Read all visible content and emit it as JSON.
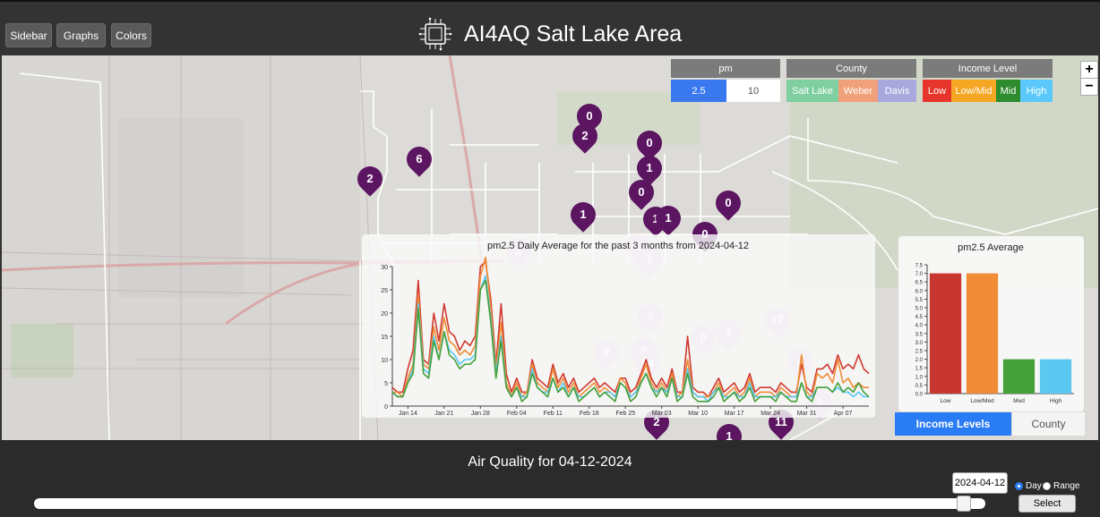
{
  "header": {
    "sidebar_label": "Sidebar",
    "graphs_label": "Graphs",
    "colors_label": "Colors",
    "title": "AI4AQ Salt Lake Area"
  },
  "filters": {
    "pm": {
      "title": "pm",
      "options": [
        "2.5",
        "10"
      ],
      "selected": "2.5"
    },
    "county": {
      "title": "County",
      "options": [
        "Salt Lake",
        "Weber",
        "Davis"
      ]
    },
    "income": {
      "title": "Income Level",
      "options": [
        "Low",
        "Low/Mid",
        "Mid",
        "High"
      ]
    }
  },
  "zoom": {
    "in_label": "+",
    "out_label": "−"
  },
  "markers": [
    "0",
    "2",
    "0",
    "1",
    "6",
    "2",
    "0",
    "0",
    "1",
    "1",
    "1",
    "0",
    "1",
    "2",
    "1",
    "3",
    "1",
    "0",
    "17",
    "0",
    "0",
    "14",
    "0",
    "0",
    "2",
    "11",
    "1"
  ],
  "line_chart": {
    "title": "pm2.5 Daily Average for the past 3 months from 2024-04-12",
    "yticks": [
      "0",
      "5",
      "10",
      "15",
      "20",
      "25",
      "30"
    ],
    "xticks": [
      "Jan 14",
      "Jan 21",
      "Jan 28",
      "Feb 04",
      "Feb 11",
      "Feb 18",
      "Feb 25",
      "Mar 03",
      "Mar 10",
      "Mar 17",
      "Mar 24",
      "Mar 31",
      "Apr 07"
    ]
  },
  "bar_chart": {
    "title": "pm2.5 Average",
    "yticks": [
      "0.0",
      "0.5",
      "1.0",
      "1.5",
      "2.0",
      "2.5",
      "3.0",
      "3.5",
      "4.0",
      "4.5",
      "5.0",
      "5.5",
      "6.0",
      "6.5",
      "7.0",
      "7.5"
    ]
  },
  "chart_data": [
    {
      "type": "line",
      "title": "pm2.5 Daily Average for the past 3 months from 2024-04-12",
      "xlabel": "",
      "ylabel": "",
      "ylim": [
        0,
        30
      ],
      "x": [
        "2024-01-11",
        "2024-01-12",
        "2024-01-13",
        "2024-01-14",
        "2024-01-15",
        "2024-01-16",
        "2024-01-17",
        "2024-01-18",
        "2024-01-19",
        "2024-01-20",
        "2024-01-21",
        "2024-01-22",
        "2024-01-23",
        "2024-01-24",
        "2024-01-25",
        "2024-01-26",
        "2024-01-27",
        "2024-01-28",
        "2024-01-29",
        "2024-01-30",
        "2024-01-31",
        "2024-02-01",
        "2024-02-02",
        "2024-02-03",
        "2024-02-04",
        "2024-02-05",
        "2024-02-06",
        "2024-02-07",
        "2024-02-08",
        "2024-02-09",
        "2024-02-10",
        "2024-02-11",
        "2024-02-12",
        "2024-02-13",
        "2024-02-14",
        "2024-02-15",
        "2024-02-16",
        "2024-02-17",
        "2024-02-18",
        "2024-02-19",
        "2024-02-20",
        "2024-02-21",
        "2024-02-22",
        "2024-02-23",
        "2024-02-24",
        "2024-02-25",
        "2024-02-26",
        "2024-02-27",
        "2024-02-28",
        "2024-02-29",
        "2024-03-01",
        "2024-03-02",
        "2024-03-03",
        "2024-03-04",
        "2024-03-05",
        "2024-03-06",
        "2024-03-07",
        "2024-03-08",
        "2024-03-09",
        "2024-03-10",
        "2024-03-11",
        "2024-03-12",
        "2024-03-13",
        "2024-03-14",
        "2024-03-15",
        "2024-03-16",
        "2024-03-17",
        "2024-03-18",
        "2024-03-19",
        "2024-03-20",
        "2024-03-21",
        "2024-03-22",
        "2024-03-23",
        "2024-03-24",
        "2024-03-25",
        "2024-03-26",
        "2024-03-27",
        "2024-03-28",
        "2024-03-29",
        "2024-03-30",
        "2024-03-31",
        "2024-04-01",
        "2024-04-02",
        "2024-04-03",
        "2024-04-04",
        "2024-04-05",
        "2024-04-06",
        "2024-04-07",
        "2024-04-08",
        "2024-04-09",
        "2024-04-10",
        "2024-04-11",
        "2024-04-12"
      ],
      "series": [
        {
          "color": "#d03a2f",
          "values": [
            4,
            3,
            3,
            8,
            12,
            27,
            10,
            9,
            20,
            14,
            22,
            16,
            15,
            12,
            14,
            13,
            15,
            30,
            31,
            23,
            9,
            22,
            7,
            3,
            6,
            3,
            3,
            10,
            6,
            5,
            4,
            9,
            5,
            7,
            4,
            6,
            3,
            4,
            5,
            6,
            4,
            5,
            4,
            3,
            6,
            6,
            3,
            4,
            7,
            10,
            6,
            4,
            6,
            4,
            8,
            3,
            3,
            15,
            4,
            3,
            3,
            2,
            4,
            6,
            3,
            4,
            5,
            3,
            4,
            7,
            3,
            4,
            4,
            4,
            3,
            5,
            4,
            3,
            3,
            9,
            4,
            3,
            8,
            8,
            9,
            7,
            11,
            8,
            9,
            8,
            11,
            8,
            7
          ]
        },
        {
          "color": "#f08c35",
          "values": [
            3,
            3,
            2,
            6,
            9,
            24,
            9,
            8,
            17,
            12,
            19,
            14,
            13,
            11,
            12,
            11,
            13,
            28,
            32,
            21,
            8,
            18,
            5,
            2,
            5,
            2,
            3,
            9,
            5,
            4,
            3,
            8,
            4,
            6,
            3,
            5,
            2,
            3,
            4,
            5,
            3,
            4,
            3,
            2,
            6,
            5,
            2,
            3,
            6,
            9,
            5,
            3,
            5,
            3,
            7,
            2,
            3,
            10,
            3,
            2,
            2,
            2,
            3,
            5,
            2,
            3,
            4,
            2,
            3,
            6,
            2,
            3,
            3,
            3,
            2,
            4,
            3,
            2,
            2,
            11,
            3,
            2,
            7,
            6,
            7,
            5,
            10,
            5,
            6,
            4,
            5,
            4,
            4
          ]
        },
        {
          "color": "#5bc8f2",
          "values": [
            3,
            2,
            2,
            5,
            8,
            22,
            8,
            7,
            15,
            10,
            16,
            12,
            11,
            9,
            10,
            10,
            11,
            25,
            28,
            19,
            7,
            15,
            4,
            2,
            4,
            2,
            2,
            8,
            4,
            3,
            3,
            6,
            3,
            5,
            2,
            4,
            2,
            2,
            3,
            4,
            2,
            3,
            3,
            2,
            5,
            4,
            2,
            3,
            5,
            7,
            4,
            3,
            4,
            3,
            6,
            2,
            2,
            8,
            3,
            2,
            2,
            1,
            3,
            4,
            2,
            2,
            3,
            2,
            2,
            5,
            2,
            2,
            2,
            2,
            2,
            3,
            2,
            2,
            2,
            5,
            2,
            2,
            4,
            4,
            4,
            3,
            4,
            3,
            3,
            2,
            3,
            2,
            2
          ]
        },
        {
          "color": "#45a03a",
          "values": [
            3,
            2,
            2,
            5,
            7,
            21,
            7,
            6,
            14,
            10,
            16,
            11,
            10,
            8,
            9,
            9,
            10,
            25,
            27,
            18,
            6,
            14,
            4,
            2,
            4,
            1,
            2,
            7,
            4,
            3,
            2,
            6,
            3,
            4,
            2,
            4,
            1,
            2,
            3,
            4,
            2,
            3,
            2,
            1,
            5,
            4,
            1,
            2,
            5,
            7,
            4,
            2,
            4,
            2,
            6,
            1,
            2,
            7,
            2,
            1,
            1,
            1,
            2,
            4,
            1,
            2,
            3,
            1,
            2,
            4,
            1,
            2,
            2,
            2,
            1,
            3,
            2,
            1,
            1,
            5,
            2,
            1,
            4,
            4,
            4,
            3,
            5,
            3,
            4,
            3,
            5,
            3,
            2
          ]
        }
      ]
    },
    {
      "type": "bar",
      "title": "pm2.5 Average",
      "categories": [
        "Low",
        "Low/Med",
        "Med",
        "High"
      ],
      "values": [
        7.0,
        7.0,
        2.0,
        2.0
      ],
      "colors": [
        "#c7372f",
        "#f08c35",
        "#45a03a",
        "#5bc8f2"
      ],
      "ylim": [
        0,
        7.5
      ]
    }
  ],
  "tabs": {
    "income_label": "Income Levels",
    "county_label": "County"
  },
  "bottom": {
    "title": "Air Quality for 04-12-2024",
    "date_value": "2024-04-12",
    "day_label": "Day",
    "range_label": "Range",
    "select_label": "Select",
    "slider_position": 0.985
  },
  "colors": {
    "marker": "#5c1561",
    "active_tab": "#2a7cf5",
    "pm_selected": "#3a78f0",
    "county": [
      "#7fcfa0",
      "#f0a07a",
      "#a8a8dc"
    ],
    "income": [
      "#e8352c",
      "#f5a623",
      "#2e8b2e",
      "#5ac8fa"
    ]
  }
}
